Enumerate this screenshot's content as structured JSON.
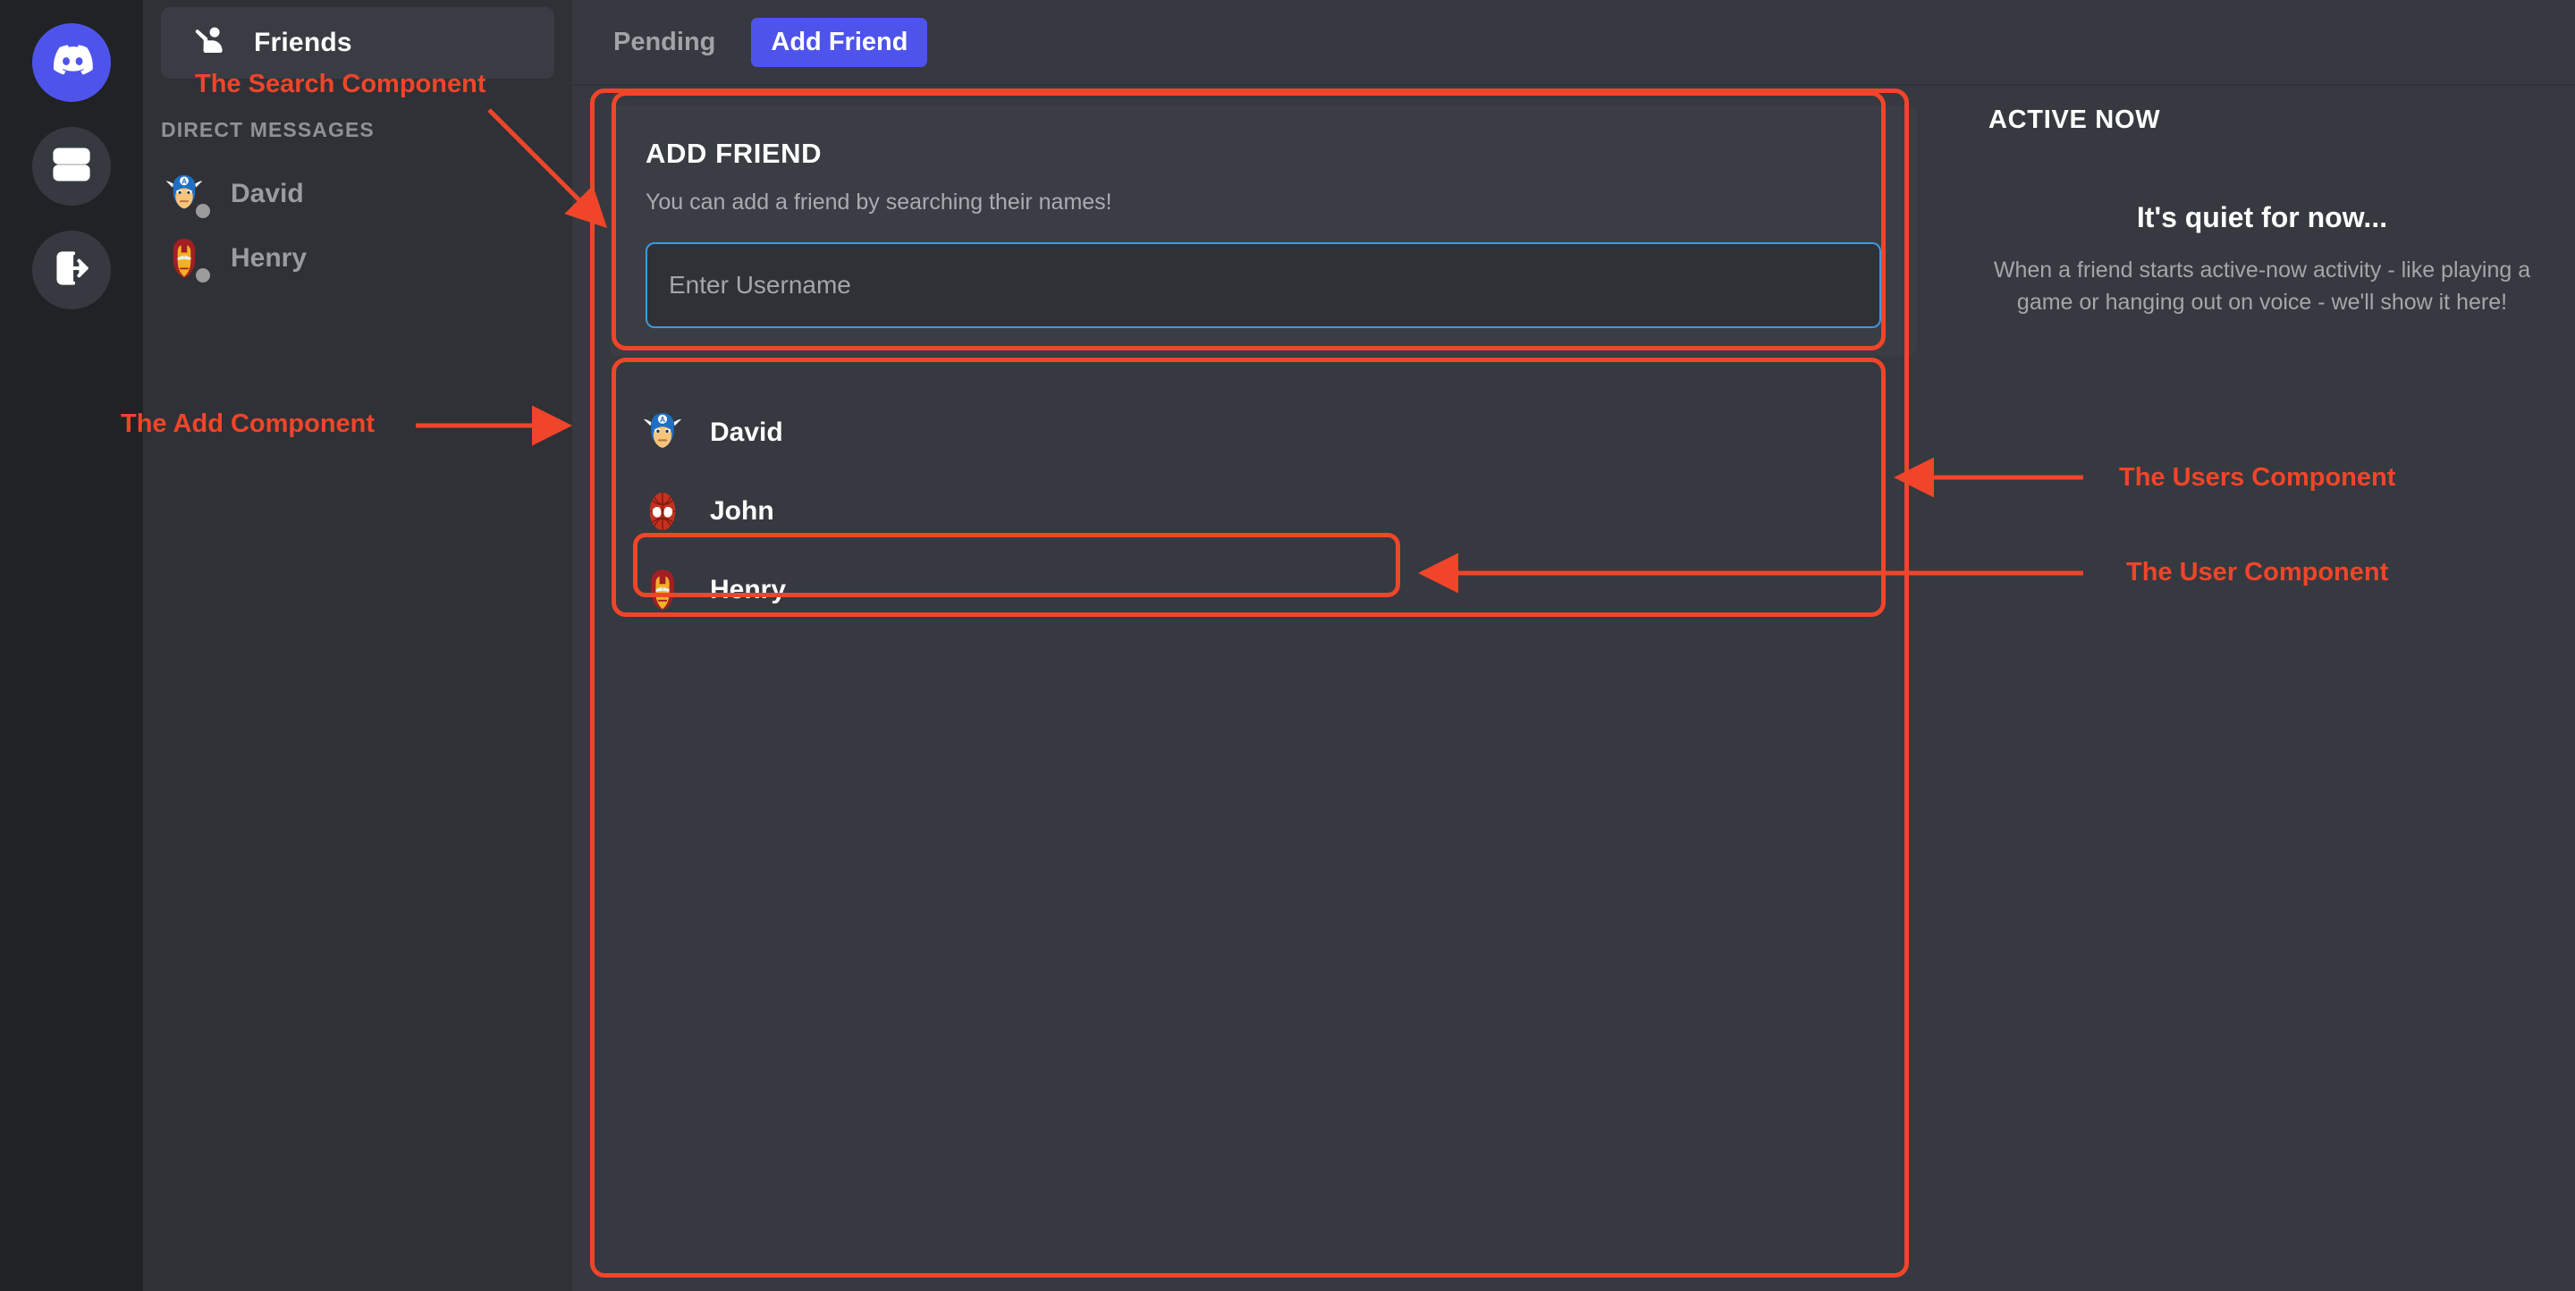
{
  "colors": {
    "rail_bg": "#202225",
    "sidebar_bg": "#2f3136",
    "main_bg": "#36393f",
    "card_bg": "#3a3d44",
    "brand_blurple": "#4e54eb",
    "input_focus_border": "#3b9ae1",
    "annotation_red": "#f0452a",
    "status_offline": "#9b9b9b",
    "muted_text": "#a3a6ab"
  },
  "rail": {
    "items": [
      {
        "icon": "discord-logo-icon",
        "active": true
      },
      {
        "icon": "server-icon",
        "active": false
      },
      {
        "icon": "logout-icon",
        "active": false
      }
    ]
  },
  "sidebar": {
    "friends_button": {
      "label": "Friends",
      "icon": "person-wave-icon"
    },
    "dm_heading": "DIRECT MESSAGES",
    "dms": [
      {
        "name": "David",
        "avatar": "captain-america-avatar",
        "status": "offline"
      },
      {
        "name": "Henry",
        "avatar": "iron-man-avatar",
        "status": "offline"
      }
    ]
  },
  "topbar": {
    "pending_label": "Pending",
    "add_friend_label": "Add Friend"
  },
  "add_friend_card": {
    "title": "ADD FRIEND",
    "subtitle": "You can add a friend by searching their names!",
    "input_value": "",
    "input_placeholder": "Enter Username"
  },
  "users": {
    "list": [
      {
        "name": "David",
        "avatar": "captain-america-avatar",
        "highlighted": false
      },
      {
        "name": "John",
        "avatar": "spider-man-avatar",
        "highlighted": false
      },
      {
        "name": "Henry",
        "avatar": "iron-man-avatar",
        "highlighted": true
      }
    ]
  },
  "active_now": {
    "title": "ACTIVE NOW",
    "empty_heading": "It's quiet for now...",
    "empty_body": "When a friend starts active-now activity - like playing a game or hanging out on voice - we'll show it here!"
  },
  "annotations": {
    "search_component": "The Search Component",
    "add_component": "The Add Component",
    "users_component": "The Users Component",
    "user_component": "The User Component"
  }
}
